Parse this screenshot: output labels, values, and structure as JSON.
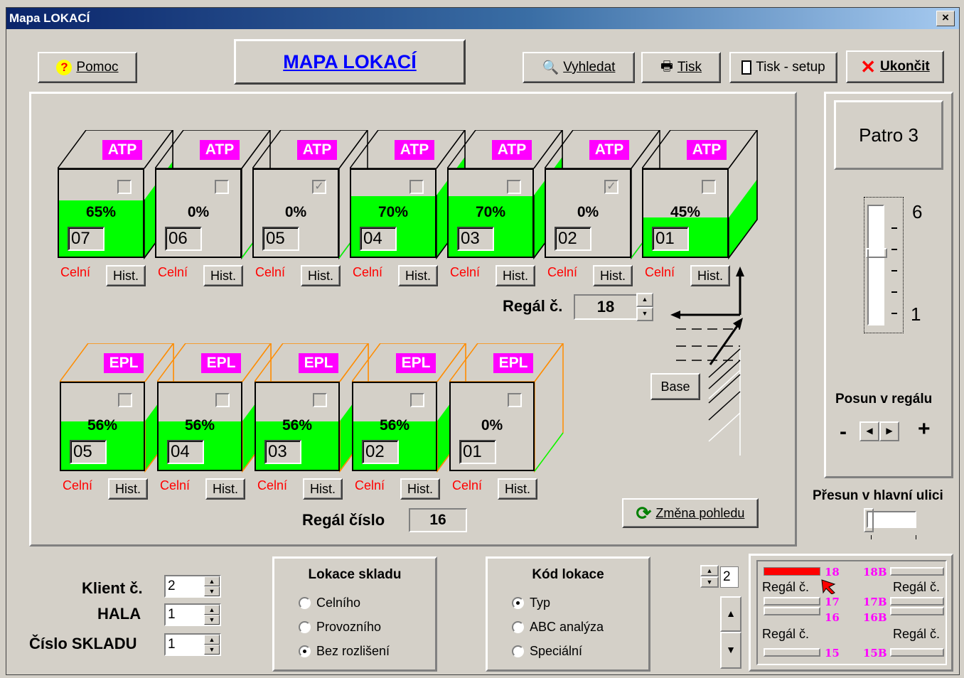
{
  "window": {
    "title": "Mapa LOKACÍ",
    "close": "×"
  },
  "toolbar": {
    "help": "Pomoc",
    "title": "MAPA LOKACÍ",
    "search": "Vyhledat",
    "print": "Tisk",
    "print_setup": "Tisk - setup",
    "exit": "Ukončit"
  },
  "top_rack": {
    "tag": "ATP",
    "front_label": "Celní",
    "hist_label": "Hist.",
    "cells": [
      {
        "num": "07",
        "pct": "65%",
        "fill": 0.65,
        "checked": false
      },
      {
        "num": "06",
        "pct": "0%",
        "fill": 0,
        "checked": false
      },
      {
        "num": "05",
        "pct": "0%",
        "fill": 0,
        "checked": true
      },
      {
        "num": "04",
        "pct": "70%",
        "fill": 0.7,
        "checked": false
      },
      {
        "num": "03",
        "pct": "70%",
        "fill": 0.7,
        "checked": false
      },
      {
        "num": "02",
        "pct": "0%",
        "fill": 0,
        "checked": true
      },
      {
        "num": "01",
        "pct": "45%",
        "fill": 0.45,
        "checked": false
      }
    ],
    "regal_label": "Regál č.",
    "regal_value": "18"
  },
  "bottom_rack": {
    "tag": "EPL",
    "front_label": "Celní",
    "hist_label": "Hist.",
    "cells": [
      {
        "num": "05",
        "pct": "56%",
        "fill": 0.56,
        "checked": false
      },
      {
        "num": "04",
        "pct": "56%",
        "fill": 0.56,
        "checked": false
      },
      {
        "num": "03",
        "pct": "56%",
        "fill": 0.56,
        "checked": false
      },
      {
        "num": "02",
        "pct": "56%",
        "fill": 0.56,
        "checked": false
      },
      {
        "num": "01",
        "pct": "0%",
        "fill": 0,
        "checked": false
      }
    ],
    "regal_label": "Regál číslo",
    "regal_value": "16"
  },
  "base_button": "Base",
  "change_view": "Změna pohledu",
  "floor": {
    "label": "Patro 3",
    "max": "6",
    "min": "1",
    "level": 0.6
  },
  "shift_rack": {
    "label": "Posun v regálu",
    "minus": "-",
    "plus": "+"
  },
  "shift_street": {
    "label": "Přesun v hlavní ulici"
  },
  "client": {
    "label": "Klient č.",
    "value": "2"
  },
  "hall": {
    "label": "HALA",
    "value": "1"
  },
  "warehouse": {
    "label": "Číslo SKLADU",
    "value": "1"
  },
  "location_group": {
    "title": "Lokace skladu",
    "options": [
      "Celního",
      "Provozního",
      "Bez rozlišení"
    ],
    "selected": 2
  },
  "code_group": {
    "title": "Kód lokace",
    "options": [
      "Typ",
      "ABC analýza",
      "Speciální"
    ],
    "selected": 0
  },
  "small_spin": {
    "value": "2"
  },
  "minimap": {
    "label": "Regál č.",
    "left_numbers": [
      "18",
      "17",
      "16",
      "15"
    ],
    "right_numbers": [
      "18B",
      "17B",
      "16B",
      "15B"
    ]
  }
}
